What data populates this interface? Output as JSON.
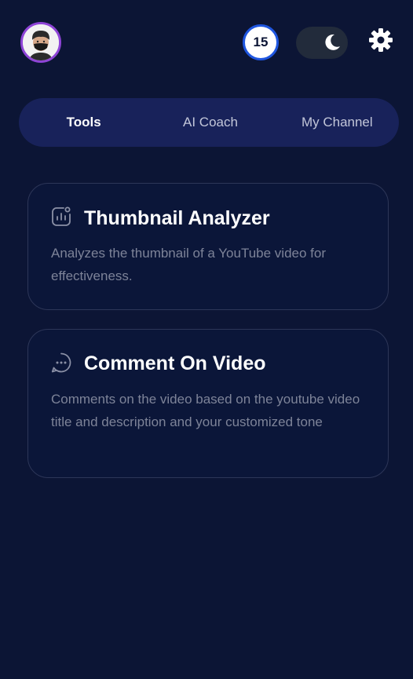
{
  "header": {
    "avatar_icon": "user-avatar-icon",
    "credits": "15",
    "theme_icon": "moon-icon",
    "settings_icon": "gear-icon",
    "colors": {
      "background": "#0c1535",
      "avatar_ring": "#8e44d6",
      "credits_ring": "#1f56e0",
      "toggle_bg": "#222b3b"
    }
  },
  "tabs": [
    {
      "label": "Tools",
      "active": true
    },
    {
      "label": "AI Coach",
      "active": false
    },
    {
      "label": "My Channel",
      "active": false
    }
  ],
  "tools": [
    {
      "icon": "chart-analyze-icon",
      "title": "Thumbnail Analyzer",
      "description": "Analyzes the thumbnail of a YouTube video for effectiveness."
    },
    {
      "icon": "chat-bubble-icon",
      "title": "Comment On Video",
      "description": "Comments on the video based on the youtube video title and description and your customized tone"
    }
  ]
}
